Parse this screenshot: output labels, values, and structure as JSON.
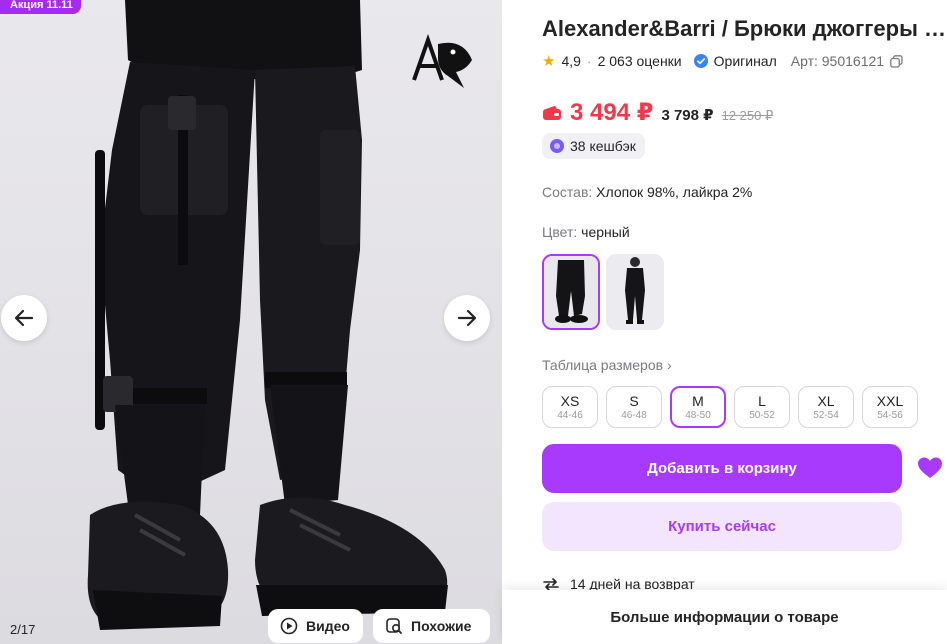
{
  "gallery": {
    "promo_badge": "Акция 11.11",
    "counter": "2/17",
    "prev_icon": "arrow-left-icon",
    "next_icon": "arrow-right-icon",
    "video_label": "Видео",
    "similar_label": "Похожие",
    "logo_text": "AB"
  },
  "product": {
    "title": "Alexander&Barri / Брюки джоггеры мужские",
    "rating": "4,9",
    "reviews": "2 063 оценки",
    "original_label": "Оригинал",
    "article_label": "Арт:",
    "article_value": "95016121"
  },
  "price": {
    "main": "3 494 ₽",
    "wallet_price": "3 798 ₽",
    "old": "12 250 ₽",
    "cashback": "38 кешбэк",
    "accent_color": "#f2384a"
  },
  "composition": {
    "label": "Состав:",
    "value": "Хлопок 98%, лайкра 2%"
  },
  "color": {
    "label": "Цвет:",
    "value": "черный"
  },
  "sizes": {
    "table_link": "Таблица размеров",
    "items": [
      {
        "size": "XS",
        "range": "44-46"
      },
      {
        "size": "S",
        "range": "46-48"
      },
      {
        "size": "M",
        "range": "48-50"
      },
      {
        "size": "L",
        "range": "50-52"
      },
      {
        "size": "XL",
        "range": "52-54"
      },
      {
        "size": "XXL",
        "range": "54-56"
      }
    ],
    "selected": "M"
  },
  "actions": {
    "add_to_cart": "Добавить в корзину",
    "buy_now": "Купить сейчас",
    "brand_color": "#a73afd"
  },
  "returns": {
    "text": "14 дней на возврат"
  },
  "footer": {
    "more_info": "Больше информации о товаре"
  }
}
